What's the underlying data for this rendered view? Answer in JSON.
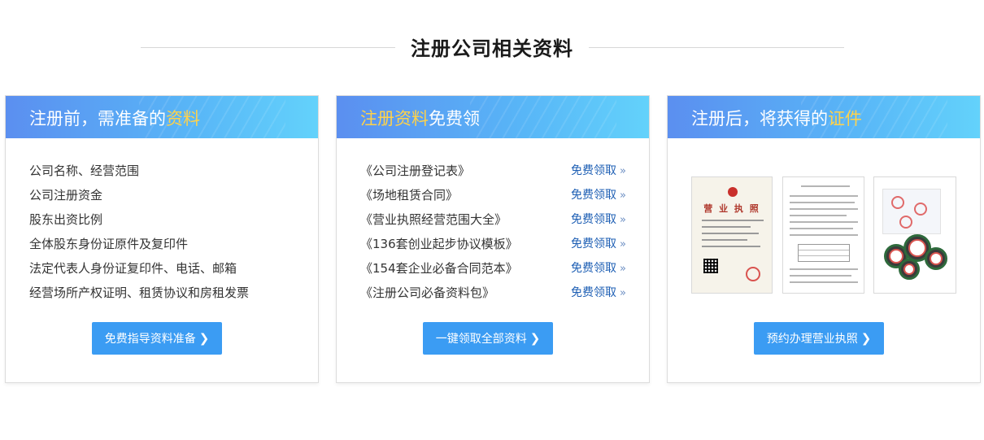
{
  "section": {
    "title": "注册公司相关资料"
  },
  "cards": [
    {
      "title_prefix": "注册前，需准备的",
      "title_highlight": "资料",
      "title_suffix": "",
      "items": [
        "公司名称、经营范围",
        "公司注册资金",
        "股东出资比例",
        "全体股东身份证原件及复印件",
        "法定代表人身份证复印件、电话、邮箱",
        "经营场所产权证明、租赁协议和房租发票"
      ],
      "button": "免费指导资料准备"
    },
    {
      "title_prefix": "",
      "title_highlight": "注册资料",
      "title_suffix": "免费领",
      "downloads": [
        {
          "name": "《公司注册登记表》",
          "action": "免费领取"
        },
        {
          "name": "《场地租赁合同》",
          "action": "免费领取"
        },
        {
          "name": "《营业执照经营范围大全》",
          "action": "免费领取"
        },
        {
          "name": "《136套创业起步协议模板》",
          "action": "免费领取"
        },
        {
          "name": "《154套企业必备合同范本》",
          "action": "免费领取"
        },
        {
          "name": "《注册公司必备资料包》",
          "action": "免费领取"
        }
      ],
      "button": "一键领取全部资料"
    },
    {
      "title_prefix": "注册后，将获得的",
      "title_highlight": "证件",
      "title_suffix": "",
      "license_text": "营 业 执 照",
      "button": "预约办理营业执照"
    }
  ],
  "colors": {
    "header_start": "#5b8ff0",
    "header_end": "#63d2fb",
    "highlight": "#ffd24a",
    "button": "#3b9cf3",
    "link": "#1e5fb4"
  },
  "icons": {
    "arrow_double": "»",
    "chevron": "❯"
  }
}
